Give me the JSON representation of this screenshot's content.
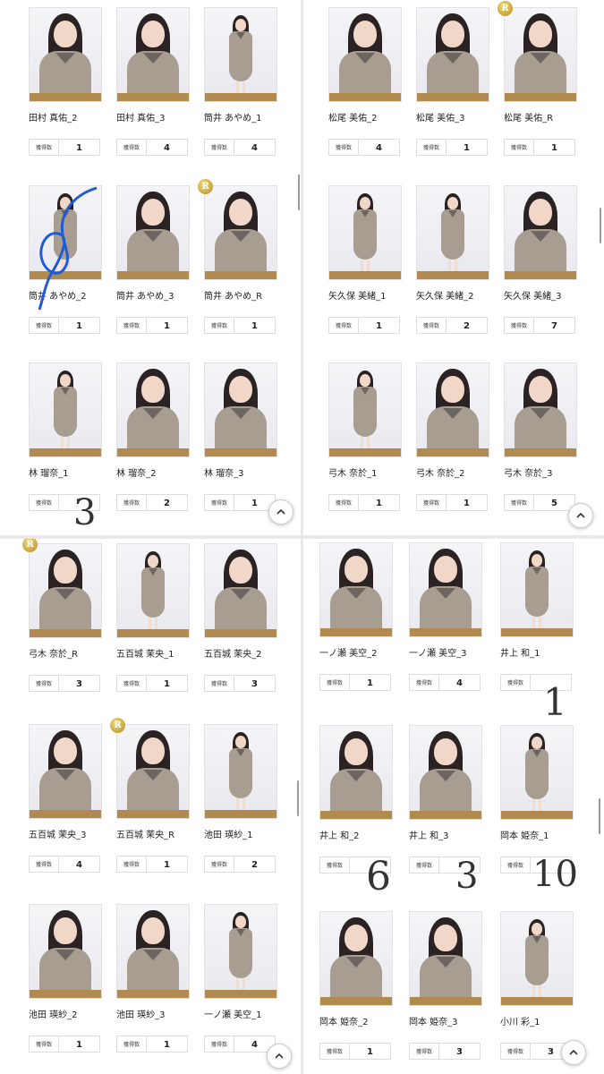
{
  "count_label": "獲得数",
  "rare_badge": "R",
  "panels": {
    "top_left": [
      {
        "name": "田村 真佑_2",
        "count": "1"
      },
      {
        "name": "田村 真佑_3",
        "count": "4"
      },
      {
        "name": "筒井 あやめ_1",
        "count": "4"
      },
      {
        "name": "筒井 あやめ_2",
        "count": "1"
      },
      {
        "name": "筒井 あやめ_3",
        "count": "1"
      },
      {
        "name": "筒井 あやめ_R",
        "count": "1"
      },
      {
        "name": "林 瑠奈_1",
        "count": ""
      },
      {
        "name": "林 瑠奈_2",
        "count": "2"
      },
      {
        "name": "林 瑠奈_3",
        "count": "1"
      }
    ],
    "top_right": [
      {
        "name": "松尾 美佑_2",
        "count": "4"
      },
      {
        "name": "松尾 美佑_3",
        "count": "1"
      },
      {
        "name": "松尾 美佑_R",
        "count": "1"
      },
      {
        "name": "矢久保 美緒_1",
        "count": "1"
      },
      {
        "name": "矢久保 美緒_2",
        "count": "2"
      },
      {
        "name": "矢久保 美緒_3",
        "count": "7"
      },
      {
        "name": "弓木 奈於_1",
        "count": "1"
      },
      {
        "name": "弓木 奈於_2",
        "count": "1"
      },
      {
        "name": "弓木 奈於_3",
        "count": "5"
      }
    ],
    "bottom_left": [
      {
        "name": "弓木 奈於_R",
        "count": "3"
      },
      {
        "name": "五百城 茉央_1",
        "count": "1"
      },
      {
        "name": "五百城 茉央_2",
        "count": "3"
      },
      {
        "name": "五百城 茉央_3",
        "count": "4"
      },
      {
        "name": "五百城 茉央_R",
        "count": "1"
      },
      {
        "name": "池田 瑛紗_1",
        "count": "2"
      },
      {
        "name": "池田 瑛紗_2",
        "count": "1"
      },
      {
        "name": "池田 瑛紗_3",
        "count": "1"
      },
      {
        "name": "一ノ瀬 美空_1",
        "count": "4"
      }
    ],
    "bottom_right": [
      {
        "name": "一ノ瀬 美空_2",
        "count": "1"
      },
      {
        "name": "一ノ瀬 美空_3",
        "count": "4"
      },
      {
        "name": "井上 和_1",
        "count": ""
      },
      {
        "name": "井上 和_2",
        "count": ""
      },
      {
        "name": "井上 和_3",
        "count": ""
      },
      {
        "name": "岡本 姫奈_1",
        "count": ""
      },
      {
        "name": "岡本 姫奈_2",
        "count": "1"
      },
      {
        "name": "岡本 姫奈_3",
        "count": "3"
      },
      {
        "name": "小川 彩_1",
        "count": "3"
      }
    ]
  },
  "handwritten": {
    "tl_count": "3",
    "br_inoue1": "1",
    "br_inoue2": "6",
    "br_inoue3": "3",
    "br_okamoto1": "10"
  },
  "colors": {
    "photo_strip": "#b08a4e",
    "rare_gold": "#d4a73a",
    "annotation_blue": "#1e5bd6"
  }
}
